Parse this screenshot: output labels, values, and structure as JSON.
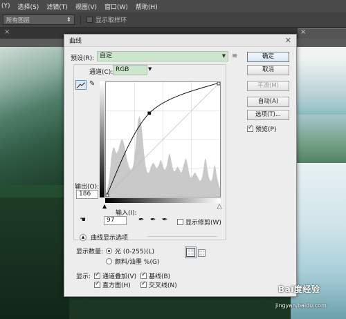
{
  "menu": [
    "(Y)",
    "选择(S)",
    "滤镜(T)",
    "视图(V)",
    "窗口(W)",
    "帮助(H)"
  ],
  "options_bar": {
    "layer_select_value": "所有图层",
    "sample_rings_label": "显示取样环"
  },
  "tab": {
    "close_glyph": "×"
  },
  "dialog": {
    "title": "曲线",
    "close_glyph": "✕",
    "preset_label": "预设(R):",
    "preset_value": "自定",
    "channel_label": "通道(C):",
    "channel_value": "RGB",
    "output_label": "输出(O):",
    "output_value": "186",
    "input_label": "输入(I):",
    "input_value": "97",
    "show_clipping_label": "显示修剪(W)",
    "disclosure_label": "曲线显示选项",
    "show_amount_label": "显示数量:",
    "radio_light_label": "光 (0-255)(L)",
    "radio_pigment_label": "颜料/油墨 %(G)",
    "show_label": "显示:",
    "cb_channel_overlays": "通道叠加(V)",
    "cb_histogram": "直方图(H)",
    "cb_baseline": "基线(B)",
    "cb_intersection": "交叉线(N)",
    "preview_label": "预览(P)",
    "buttons": {
      "ok": "确定",
      "cancel": "取消",
      "smooth": "平滑(M)",
      "auto": "自动(A)",
      "options": "选项(T)..."
    }
  },
  "curve": {
    "points": [
      [
        0,
        0
      ],
      [
        97,
        186
      ],
      [
        255,
        255
      ]
    ],
    "histogram": [
      5,
      8,
      12,
      18,
      26,
      36,
      48,
      56,
      60,
      62,
      60,
      56,
      54,
      56,
      58,
      62,
      66,
      70,
      72,
      71,
      68,
      64,
      58,
      52,
      46,
      42,
      38,
      35,
      34,
      34,
      36,
      40,
      48,
      58,
      70,
      82,
      92,
      98,
      100,
      97,
      90,
      80,
      68,
      56,
      46,
      38,
      33,
      30,
      30,
      31,
      34,
      38,
      40,
      42,
      42,
      40,
      38,
      36,
      36,
      38,
      40,
      44,
      46,
      44,
      40,
      36,
      34,
      34,
      36,
      40,
      46,
      52,
      54,
      50,
      44,
      38,
      34,
      32,
      32,
      34,
      36,
      38,
      36,
      34,
      32,
      30,
      32,
      36,
      40,
      44,
      48,
      46,
      42,
      36,
      30,
      26,
      24,
      24,
      26,
      28,
      30,
      30,
      28,
      26,
      24,
      22,
      20,
      20,
      22,
      26,
      32,
      40,
      48,
      46,
      40,
      32,
      26,
      22,
      20,
      20,
      22,
      28,
      36,
      40,
      36,
      28,
      22,
      18,
      14,
      10
    ]
  },
  "watermark": {
    "logo": "Bai度经验",
    "url": "jingyan.baidu.com"
  }
}
